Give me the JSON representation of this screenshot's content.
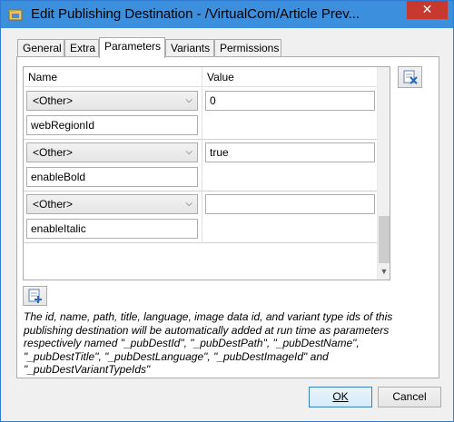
{
  "window": {
    "title": "Edit Publishing Destination - /VirtualCom/Article Prev...",
    "close_glyph": "✕"
  },
  "tabs": [
    {
      "label": "General",
      "active": false
    },
    {
      "label": "Extra",
      "active": false
    },
    {
      "label": "Parameters",
      "active": true
    },
    {
      "label": "Variants",
      "active": false
    },
    {
      "label": "Permissions",
      "active": false
    }
  ],
  "grid": {
    "columns": [
      "Name",
      "Value"
    ],
    "rows": [
      {
        "type": "<Other>",
        "name": "webRegionId",
        "value": "0"
      },
      {
        "type": "<Other>",
        "name": "enableBold",
        "value": "true"
      },
      {
        "type": "<Other>",
        "name": "enableItalic",
        "value": ""
      }
    ]
  },
  "info_text": "The id, name, path, title, language, image data id, and variant type ids of this publishing destination will be automatically added at run time as parameters respectively named \"_pubDestId\", \"_pubDestPath\", \"_pubDestName\", \"_pubDestTitle\", \"_pubDestLanguage\", \"_pubDestImageId\" and \"_pubDestVariantTypeIds\"",
  "buttons": {
    "ok": "OK",
    "cancel": "Cancel"
  },
  "icons": {
    "window": "folder-icon",
    "remove_row": "remove-row-icon",
    "add_row": "add-row-icon"
  },
  "colors": {
    "titlebar": "#3b8fdc",
    "close": "#c7392f"
  }
}
